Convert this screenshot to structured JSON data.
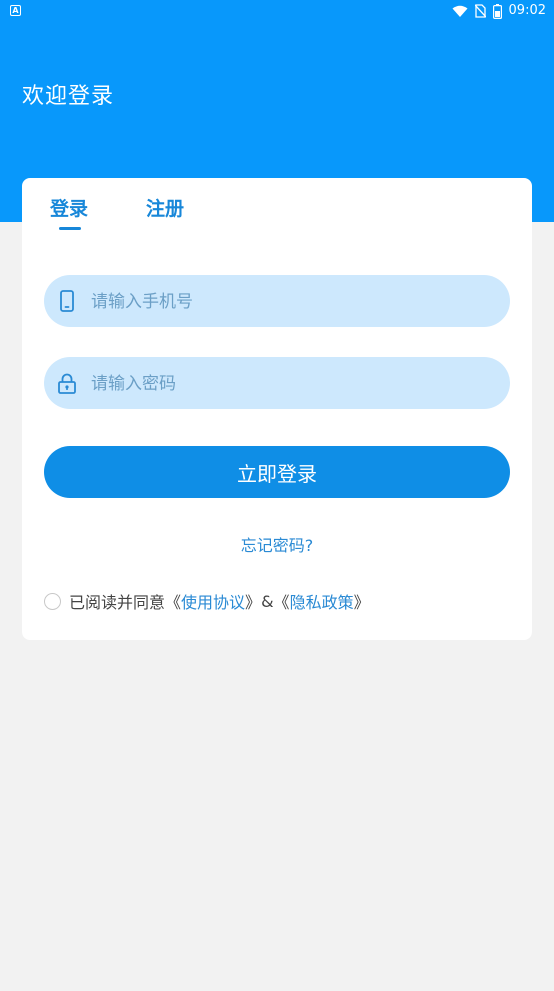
{
  "status_bar": {
    "left_icon_letter": "A",
    "time": "09:02",
    "icons": [
      "wifi-icon",
      "no-sim-icon",
      "battery-icon"
    ]
  },
  "header": {
    "title": "欢迎登录",
    "background_color": "#0898fb"
  },
  "tabs": [
    {
      "label": "登录",
      "active": true
    },
    {
      "label": "注册",
      "active": false
    }
  ],
  "form": {
    "phone_placeholder": "请输入手机号",
    "phone_icon": "phone-icon",
    "password_placeholder": "请输入密码",
    "password_icon": "lock-icon",
    "submit_label": "立即登录",
    "forgot_label": "忘记密码?"
  },
  "agreement": {
    "checked": false,
    "prefix": "已阅读并同意",
    "open_bracket_1": "《",
    "user_agreement": "使用协议",
    "close_bracket_1": "》",
    "ampersand": "&",
    "open_bracket_2": "《",
    "privacy_policy": "隐私政策",
    "close_bracket_2": "》"
  },
  "colors": {
    "accent": "#1787d9",
    "button": "#0f8ee6",
    "input_bg": "#cde8fd",
    "page_bg": "#f2f2f2"
  }
}
